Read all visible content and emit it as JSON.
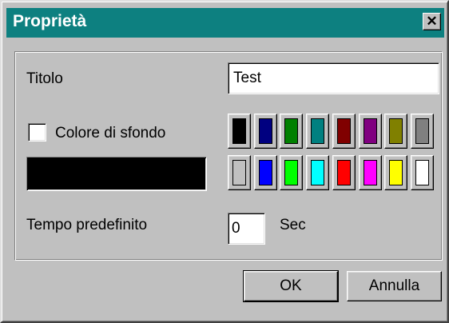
{
  "window": {
    "title": "Proprietà",
    "close_glyph": "✕"
  },
  "form": {
    "title_label": "Titolo",
    "title_value": "Test",
    "background_checkbox_label": "Colore di sfondo",
    "background_checked": false,
    "default_time_label": "Tempo predefinito",
    "default_time_value": "0",
    "time_unit": "Sec"
  },
  "palette": {
    "top_row": [
      "#000000",
      "#000080",
      "#008000",
      "#008080",
      "#800000",
      "#800080",
      "#808000",
      "#808080"
    ],
    "bottom_row": [
      "#c0c0c0",
      "#0000ff",
      "#00ff00",
      "#00ffff",
      "#ff0000",
      "#ff00ff",
      "#ffff00",
      "#ffffff"
    ],
    "selected_preview_color": "#000000"
  },
  "buttons": {
    "ok_label": "OK",
    "cancel_label": "Annulla"
  }
}
